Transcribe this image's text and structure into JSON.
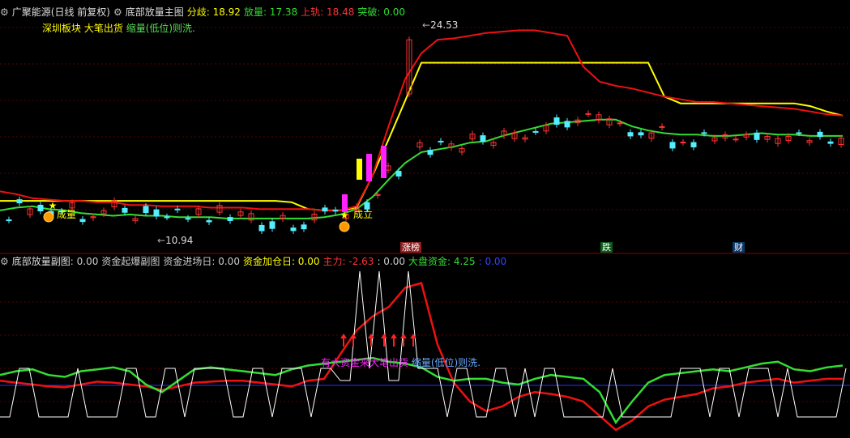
{
  "main": {
    "stock_name": "广聚能源(日线 前复权)",
    "indicator_name": "底部放量主图",
    "items": [
      {
        "label": "分歧:",
        "value": "18.92",
        "color": "#ffff00"
      },
      {
        "label": "放量:",
        "value": "17.38",
        "color": "#33dd33"
      },
      {
        "label": "上轨:",
        "value": "18.48",
        "color": "#ff3333"
      },
      {
        "label": "突破:",
        "value": "0.00",
        "color": "#33dd33"
      }
    ],
    "sector_label": "深圳板块",
    "note_sell": "大笔出货",
    "note_shrink": "缩量(低位)则洗.",
    "price_high": "24.53",
    "price_low": "10.94",
    "signal_volume": "成量",
    "signal_setup": "成立",
    "tags": [
      {
        "text": "涨榜",
        "bg": "#8b1f1f",
        "color": "#ffffff"
      },
      {
        "text": "跌",
        "bg": "#0a5c1a",
        "color": "#ffffff"
      },
      {
        "text": "财",
        "bg": "#0a3a6a",
        "color": "#ffffff"
      }
    ],
    "colors": {
      "up": "#ff3333",
      "down": "#55eeff",
      "yellow": "#ffff00",
      "green": "#33dd33",
      "red": "#ee1111",
      "magenta": "#ff22ff"
    }
  },
  "sub": {
    "indicator_name": "底部放量副图",
    "items": [
      {
        "label": ":",
        "value": "0.00",
        "color": "#cccccc"
      },
      {
        "label": "资金起爆副图",
        "value": "",
        "color": "#cccccc"
      },
      {
        "label": "资金进场日:",
        "value": "0.00",
        "color": "#cccccc"
      },
      {
        "label": "资金加仓日:",
        "value": "0.00",
        "color": "#ffff00"
      },
      {
        "label": "主力:",
        "value": "-2.63",
        "color": "#ff3333"
      },
      {
        "label": ":",
        "value": "0.00",
        "color": "#cccccc"
      },
      {
        "label": "大盘资金:",
        "value": "4.25",
        "color": "#33dd33"
      },
      {
        "label": ":",
        "value": "0.00",
        "color": "#3344ff"
      }
    ],
    "note_capital": "有大资金来",
    "note_sell": "大笔出货",
    "note_shrink": "缩量(低位)则洗."
  },
  "chart_data": [
    {
      "type": "line",
      "title": "底部放量主图",
      "x": [
        0,
        20,
        40,
        60,
        80,
        100,
        120,
        140,
        160,
        180,
        200,
        220,
        240,
        260,
        280,
        300,
        320,
        340,
        360,
        380,
        400,
        420,
        440,
        460,
        480,
        500,
        520,
        540,
        560,
        580,
        600,
        620,
        640,
        660,
        680,
        700,
        720,
        740,
        760,
        780,
        800,
        820,
        840,
        860,
        880,
        900,
        920,
        940,
        960,
        980,
        1000,
        1020,
        1040
      ],
      "series": [
        {
          "name": "分歧",
          "color": "#ffff00",
          "values": [
            12.6,
            12.6,
            12.6,
            12.6,
            12.6,
            12.6,
            12.6,
            12.6,
            12.6,
            12.6,
            12.6,
            12.6,
            12.6,
            12.6,
            12.6,
            12.6,
            12.6,
            12.6,
            12.5,
            12.0,
            11.9,
            11.9,
            12.1,
            14.5,
            17.2,
            20.0,
            22.8,
            22.8,
            22.8,
            22.8,
            22.8,
            22.8,
            22.8,
            22.8,
            22.8,
            22.8,
            22.8,
            22.8,
            22.8,
            22.8,
            22.8,
            20.3,
            19.8,
            19.8,
            19.8,
            19.8,
            19.8,
            19.8,
            19.8,
            19.8,
            19.6,
            19.2,
            18.9
          ]
        },
        {
          "name": "放量",
          "color": "#33dd33",
          "values": [
            11.9,
            12.1,
            12.2,
            12.0,
            11.9,
            11.7,
            11.6,
            11.5,
            11.6,
            11.5,
            11.5,
            11.4,
            11.4,
            11.4,
            11.3,
            11.3,
            11.3,
            11.3,
            11.3,
            11.3,
            11.4,
            11.6,
            12.0,
            12.9,
            14.2,
            15.4,
            16.2,
            16.4,
            16.6,
            16.9,
            17.0,
            17.4,
            17.7,
            18.0,
            18.3,
            18.4,
            18.5,
            18.6,
            18.6,
            18.1,
            17.8,
            17.6,
            17.5,
            17.5,
            17.4,
            17.4,
            17.5,
            17.6,
            17.5,
            17.5,
            17.4,
            17.4,
            17.4
          ]
        },
        {
          "name": "上轨",
          "color": "#ee1111",
          "values": [
            13.3,
            13.1,
            12.8,
            12.7,
            12.6,
            12.6,
            12.5,
            12.5,
            12.3,
            12.3,
            12.2,
            12.2,
            12.2,
            12.1,
            12.1,
            12.1,
            12.0,
            12.0,
            12.0,
            12.0,
            11.9,
            11.9,
            12.2,
            14.5,
            18.2,
            21.6,
            23.5,
            24.5,
            24.6,
            24.8,
            25.0,
            25.1,
            25.2,
            25.2,
            25.0,
            24.8,
            22.5,
            21.4,
            21.1,
            20.9,
            20.6,
            20.3,
            20.1,
            19.9,
            19.9,
            19.8,
            19.7,
            19.6,
            19.5,
            19.4,
            19.2,
            19.0,
            18.9
          ]
        }
      ],
      "annotations": [
        "24.53",
        "10.94"
      ],
      "xlabel": "",
      "ylabel": ""
    },
    {
      "type": "line",
      "title": "底部放量副图",
      "x": [
        0,
        20,
        40,
        60,
        80,
        100,
        120,
        140,
        160,
        180,
        200,
        220,
        240,
        260,
        280,
        300,
        320,
        340,
        360,
        380,
        400,
        420,
        440,
        460,
        480,
        500,
        520,
        540,
        560,
        580,
        600,
        620,
        640,
        660,
        680,
        700,
        720,
        740,
        760,
        780,
        800,
        820,
        840,
        860,
        880,
        900,
        920,
        940,
        960,
        980,
        1000,
        1020,
        1040
      ],
      "series": [
        {
          "name": "主力",
          "color": "#ee1111",
          "values": [
            -8,
            -10,
            -12,
            -14,
            -15,
            -12,
            -9,
            -10,
            -12,
            -14,
            -18,
            -14,
            -10,
            -9,
            -8,
            -8,
            -10,
            -12,
            -14,
            -8,
            -6,
            20,
            45,
            60,
            70,
            90,
            95,
            30,
            -10,
            -30,
            -40,
            -35,
            -25,
            -20,
            -22,
            -25,
            -30,
            -45,
            -60,
            -50,
            -35,
            -28,
            -25,
            -22,
            -16,
            -14,
            -10,
            -8,
            -6,
            -10,
            -8,
            -6,
            -6
          ]
        },
        {
          "name": "大盘资金",
          "color": "#33dd33",
          "values": [
            -2,
            2,
            4,
            -2,
            -4,
            2,
            4,
            6,
            2,
            -12,
            -20,
            -8,
            4,
            6,
            4,
            2,
            0,
            -2,
            4,
            8,
            10,
            12,
            14,
            16,
            12,
            10,
            6,
            -4,
            -8,
            -6,
            -6,
            -10,
            -12,
            -6,
            -2,
            -4,
            -6,
            -20,
            -52,
            -30,
            -10,
            -2,
            0,
            2,
            4,
            2,
            6,
            10,
            12,
            4,
            2,
            6,
            8
          ]
        }
      ],
      "xlabel": "",
      "ylabel": ""
    }
  ]
}
